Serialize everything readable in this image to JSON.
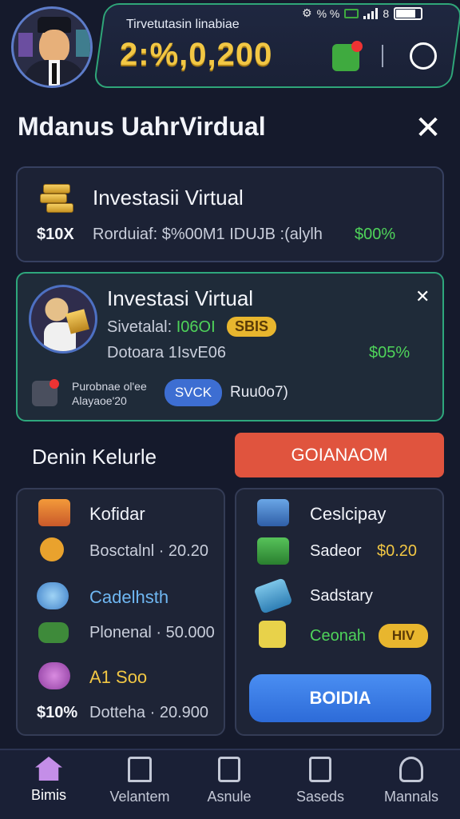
{
  "header": {
    "balance_label": "Tirvetutasin linabiae",
    "balance_value": "2:%,0,200",
    "status_text": "% %",
    "status_extra": "8"
  },
  "title": {
    "text": "Mdanus UahrVirdual",
    "close_glyph": "✕"
  },
  "card1": {
    "title": "Investasii Virtual",
    "left_value": "$10X",
    "middle_text": "Rorduiaf: $%00M1 IDUJB :(alylh",
    "right_value": "$00%"
  },
  "card2": {
    "title": "Investasi Virtual",
    "close_glyph": "✕",
    "row1_label": "Sivetalal:",
    "row1_value": "I06OI",
    "badge": "SBIS",
    "row2_text": "Dotoara 1IsvE06",
    "percent": "$05%",
    "mini_text_line1": "Purobnae ol'ee",
    "mini_text_line2": "Alayaoe'20",
    "button_label": "SVCK",
    "button_side_text": "Ruu0o7)"
  },
  "section": {
    "title": "Denin Kelurle",
    "red_button": "GOIANAOM"
  },
  "left_panel": {
    "items": [
      {
        "label": "Kofidar",
        "label_color": "#f1f3f9",
        "sub": "Bosctalnl · 20.20",
        "icon": "book-stack-icon"
      },
      {
        "label": "Cadelhsth",
        "label_color": "#6fb7f2",
        "sub": "Plonenal · 50.000",
        "icon": "cloud-icon"
      },
      {
        "label": "A1 Soo",
        "label_color": "#f2c744",
        "sub": "Dotteha · 20.900",
        "sub_prefix": "$10%",
        "icon": "grapes-icon"
      }
    ]
  },
  "right_panel": {
    "items": [
      {
        "label": "Ceslcipay",
        "icon": "calculator-icon"
      },
      {
        "label": "Sadeor",
        "value": "$0.20",
        "icon": "leaf-icon"
      },
      {
        "label": "Sadstary",
        "icon": "ticket-icon"
      },
      {
        "label": "Ceonah",
        "icon": "document-icon",
        "badge": "HIV"
      }
    ],
    "primary_button": "BOIDIA"
  },
  "nav": {
    "items": [
      {
        "label": "Bimis",
        "icon": "home-icon"
      },
      {
        "label": "Velantem",
        "icon": "bank-icon"
      },
      {
        "label": "Asnule",
        "icon": "clipboard-icon"
      },
      {
        "label": "Saseds",
        "icon": "receipt-icon"
      },
      {
        "label": "Mannals",
        "icon": "user-icon"
      }
    ]
  },
  "colors": {
    "accent_green": "#4fd45a",
    "accent_gold": "#f2c744",
    "accent_red": "#e0543e",
    "accent_blue": "#3d6ed2",
    "bg": "#151a2c"
  }
}
